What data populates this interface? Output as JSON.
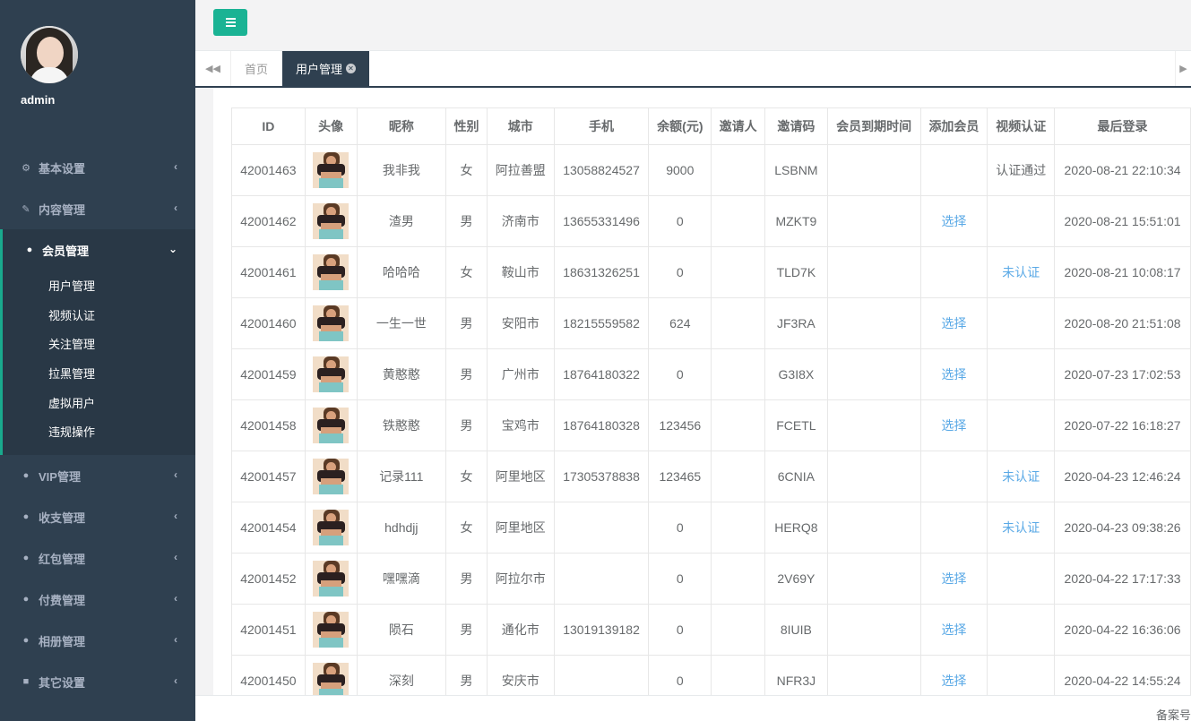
{
  "sidebar": {
    "user": "admin",
    "items": [
      {
        "label": "基本设置",
        "icon": "gear-icon",
        "arrow": "‹"
      },
      {
        "label": "内容管理",
        "icon": "edit-icon",
        "arrow": "‹"
      },
      {
        "label": "会员管理",
        "icon": "user-icon",
        "arrow": "⌄"
      },
      {
        "label": "VIP管理",
        "icon": "user-icon",
        "arrow": "‹"
      },
      {
        "label": "收支管理",
        "icon": "user-icon",
        "arrow": "‹"
      },
      {
        "label": "红包管理",
        "icon": "user-icon",
        "arrow": "‹"
      },
      {
        "label": "付费管理",
        "icon": "user-icon",
        "arrow": "‹"
      },
      {
        "label": "相册管理",
        "icon": "user-icon",
        "arrow": "‹"
      },
      {
        "label": "其它设置",
        "icon": "book-icon",
        "arrow": "‹"
      }
    ],
    "submenu": [
      "用户管理",
      "视频认证",
      "关注管理",
      "拉黑管理",
      "虚拟用户",
      "违规操作"
    ]
  },
  "tabs": {
    "home": "首页",
    "active": "用户管理",
    "close": "✕"
  },
  "table": {
    "headers": [
      "ID",
      "头像",
      "昵称",
      "性别",
      "城市",
      "手机",
      "余额(元)",
      "邀请人",
      "邀请码",
      "会员到期时间",
      "添加会员",
      "视频认证",
      "最后登录"
    ],
    "rows": [
      [
        "42001463",
        "",
        "我非我",
        "女",
        "阿拉善盟",
        "13058824527",
        "9000",
        "",
        "LSBNM",
        "",
        "",
        "认证通过",
        "2020-08-21 22:10:34"
      ],
      [
        "42001462",
        "",
        "渣男",
        "男",
        "济南市",
        "13655331496",
        "0",
        "",
        "MZKT9",
        "",
        "选择",
        "",
        "2020-08-21 15:51:01"
      ],
      [
        "42001461",
        "",
        "哈哈哈",
        "女",
        "鞍山市",
        "18631326251",
        "0",
        "",
        "TLD7K",
        "",
        "",
        "未认证",
        "2020-08-21 10:08:17"
      ],
      [
        "42001460",
        "",
        "一生一世",
        "男",
        "安阳市",
        "18215559582",
        "624",
        "",
        "JF3RA",
        "",
        "选择",
        "",
        "2020-08-20 21:51:08"
      ],
      [
        "42001459",
        "",
        "黄憨憨",
        "男",
        "广州市",
        "18764180322",
        "0",
        "",
        "G3I8X",
        "",
        "选择",
        "",
        "2020-07-23 17:02:53"
      ],
      [
        "42001458",
        "",
        "铁憨憨",
        "男",
        "宝鸡市",
        "18764180328",
        "123456",
        "",
        "FCETL",
        "",
        "选择",
        "",
        "2020-07-22 16:18:27"
      ],
      [
        "42001457",
        "",
        "记录111",
        "女",
        "阿里地区",
        "17305378838",
        "123465",
        "",
        "6CNIA",
        "",
        "",
        "未认证",
        "2020-04-23 12:46:24"
      ],
      [
        "42001454",
        "",
        "hdhdjj",
        "女",
        "阿里地区",
        "",
        "0",
        "",
        "HERQ8",
        "",
        "",
        "未认证",
        "2020-04-23 09:38:26"
      ],
      [
        "42001452",
        "",
        "嘿嘿滴",
        "男",
        "阿拉尔市",
        "",
        "0",
        "",
        "2V69Y",
        "",
        "选择",
        "",
        "2020-04-22 17:17:33"
      ],
      [
        "42001451",
        "",
        "陨石",
        "男",
        "通化市",
        "13019139182",
        "0",
        "",
        "8IUIB",
        "",
        "选择",
        "",
        "2020-04-22 16:36:06"
      ],
      [
        "42001450",
        "",
        "深刻",
        "男",
        "安庆市",
        "",
        "0",
        "",
        "NFR3J",
        "",
        "选择",
        "",
        "2020-04-22 14:55:24"
      ]
    ]
  },
  "footer": {
    "record": "备案号"
  },
  "colors": {
    "sidebar": "#2f4050",
    "accent": "#1ab394",
    "link": "#5aa9e6"
  }
}
